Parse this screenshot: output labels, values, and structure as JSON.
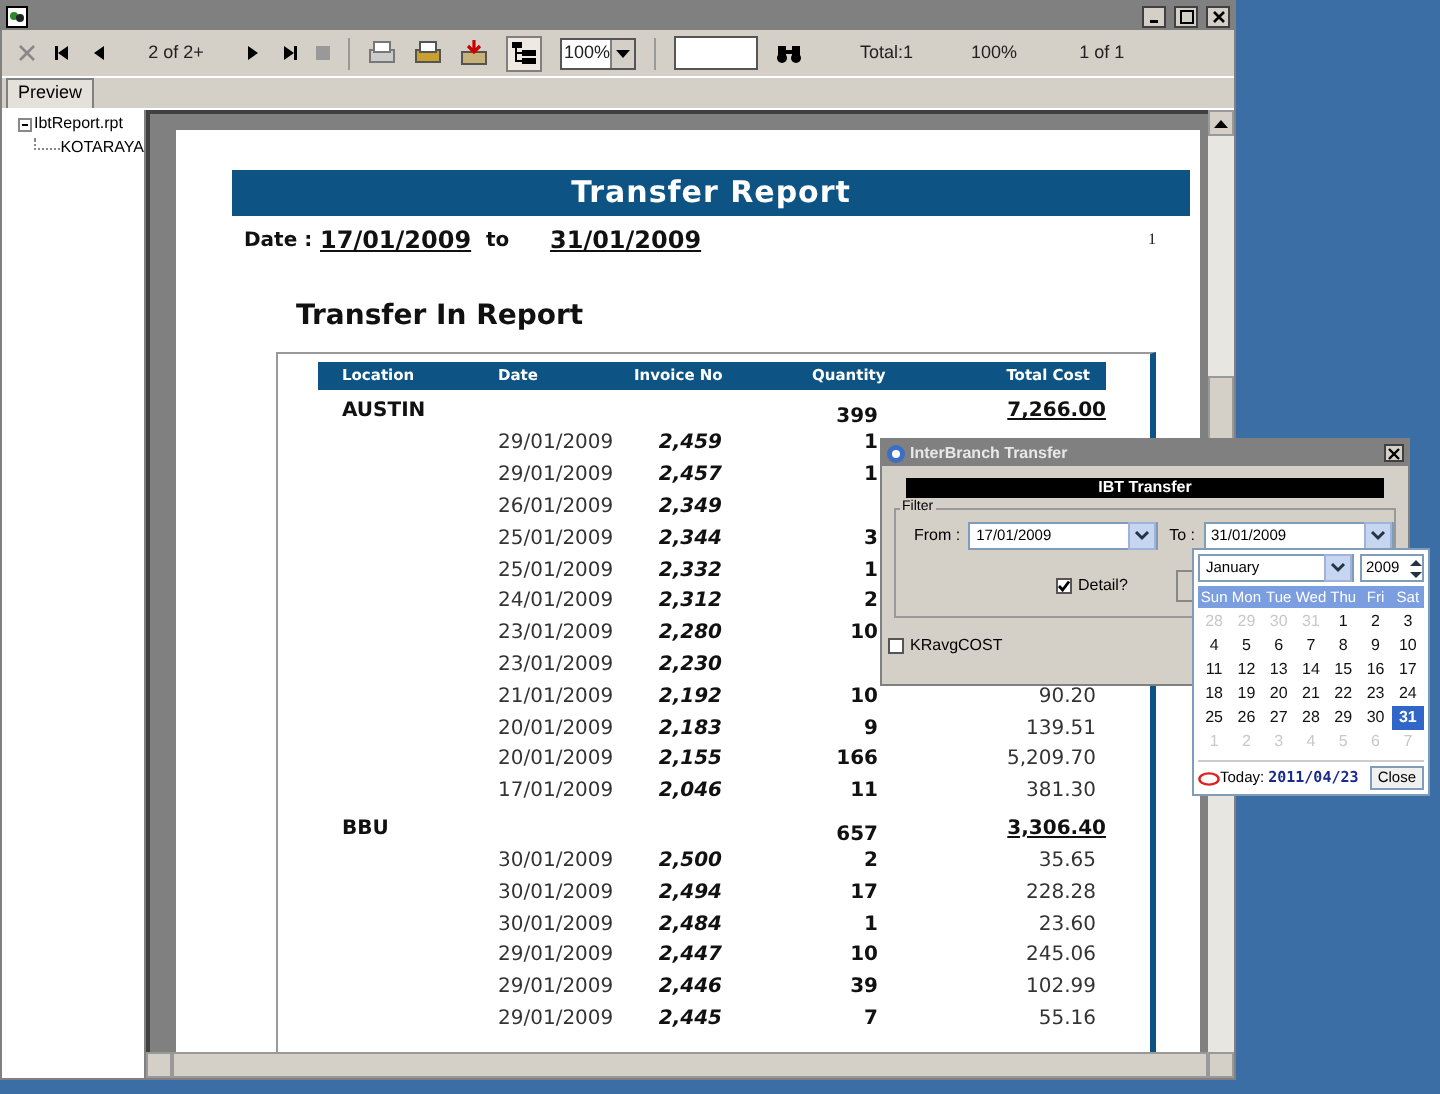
{
  "toolbar": {
    "page_indicator": "2 of 2+",
    "zoom": "100%",
    "total": "Total:1",
    "percent": "100%",
    "pages": "1 of 1",
    "group_tree_pressed": true
  },
  "tabs": [
    {
      "label": "Preview",
      "selected": true
    }
  ],
  "tree": {
    "label": "IbtReport.rpt",
    "expanded": true,
    "children": [
      {
        "label": "KOTARAYA"
      }
    ]
  },
  "report": {
    "title": "Transfer Report",
    "date_label": "Date :",
    "date_from": "17/01/2009",
    "date_to_label": "to",
    "date_to": "31/01/2009",
    "page_number": "1",
    "subtitle": "Transfer In Report",
    "columns": [
      "Location",
      "Date",
      "Invoice No",
      "Quantity",
      "Total Cost"
    ],
    "groups": [
      {
        "location": "AUSTIN",
        "quantity": "399",
        "total_cost": "7,266.00",
        "rows": [
          {
            "date": "29/01/2009",
            "invoice": "2,459",
            "quantity": "1"
          },
          {
            "date": "29/01/2009",
            "invoice": "2,457",
            "quantity": "1"
          },
          {
            "date": "26/01/2009",
            "invoice": "2,349"
          },
          {
            "date": "25/01/2009",
            "invoice": "2,344",
            "quantity": "3"
          },
          {
            "date": "25/01/2009",
            "invoice": "2,332",
            "quantity": "1"
          },
          {
            "date": "24/01/2009",
            "invoice": "2,312",
            "quantity": "2"
          },
          {
            "date": "23/01/2009",
            "invoice": "2,280",
            "quantity": "10"
          },
          {
            "date": "23/01/2009",
            "invoice": "2,230"
          },
          {
            "date": "21/01/2009",
            "invoice": "2,192",
            "quantity": "10",
            "cost": "90.20"
          },
          {
            "date": "20/01/2009",
            "invoice": "2,183",
            "quantity": "9",
            "cost": "139.51"
          },
          {
            "date": "20/01/2009",
            "invoice": "2,155",
            "quantity": "166",
            "cost": "5,209.70"
          },
          {
            "date": "17/01/2009",
            "invoice": "2,046",
            "quantity": "11",
            "cost": "381.30"
          }
        ]
      },
      {
        "location": "BBU",
        "quantity": "657",
        "total_cost": "3,306.40",
        "rows": [
          {
            "date": "30/01/2009",
            "invoice": "2,500",
            "quantity": "2",
            "cost": "35.65"
          },
          {
            "date": "30/01/2009",
            "invoice": "2,494",
            "quantity": "17",
            "cost": "228.28"
          },
          {
            "date": "30/01/2009",
            "invoice": "2,484",
            "quantity": "1",
            "cost": "23.60"
          },
          {
            "date": "29/01/2009",
            "invoice": "2,447",
            "quantity": "10",
            "cost": "245.06"
          },
          {
            "date": "29/01/2009",
            "invoice": "2,446",
            "quantity": "39",
            "cost": "102.99"
          },
          {
            "date": "29/01/2009",
            "invoice": "2,445",
            "quantity": "7",
            "cost": "55.16"
          }
        ]
      }
    ]
  },
  "dialog": {
    "title": "InterBranch Transfer",
    "header": "IBT Transfer",
    "filter_label": "Filter",
    "from_label": "From :",
    "from_value": "17/01/2009",
    "to_label": "To :",
    "to_value": "31/01/2009",
    "detail": {
      "label": "Detail?",
      "checked": true
    },
    "kravg": {
      "label": "KRavgCOST",
      "checked": false
    }
  },
  "calendar": {
    "month": "January",
    "year": "2009",
    "weekdays": [
      "Sun",
      "Mon",
      "Tue",
      "Wed",
      "Thu",
      "Fri",
      "Sat"
    ],
    "weeks": [
      [
        {
          "day": "28",
          "muted": true,
          "selected": false
        },
        {
          "day": "29",
          "muted": true,
          "selected": false
        },
        {
          "day": "30",
          "muted": true,
          "selected": false
        },
        {
          "day": "31",
          "muted": true,
          "selected": false
        },
        {
          "day": "1",
          "muted": false,
          "selected": false
        },
        {
          "day": "2",
          "muted": false,
          "selected": false
        },
        {
          "day": "3",
          "muted": false,
          "selected": false
        }
      ],
      [
        {
          "day": "4",
          "muted": false,
          "selected": false
        },
        {
          "day": "5",
          "muted": false,
          "selected": false
        },
        {
          "day": "6",
          "muted": false,
          "selected": false
        },
        {
          "day": "7",
          "muted": false,
          "selected": false
        },
        {
          "day": "8",
          "muted": false,
          "selected": false
        },
        {
          "day": "9",
          "muted": false,
          "selected": false
        },
        {
          "day": "10",
          "muted": false,
          "selected": false
        }
      ],
      [
        {
          "day": "11",
          "muted": false,
          "selected": false
        },
        {
          "day": "12",
          "muted": false,
          "selected": false
        },
        {
          "day": "13",
          "muted": false,
          "selected": false
        },
        {
          "day": "14",
          "muted": false,
          "selected": false
        },
        {
          "day": "15",
          "muted": false,
          "selected": false
        },
        {
          "day": "16",
          "muted": false,
          "selected": false
        },
        {
          "day": "17",
          "muted": false,
          "selected": false
        }
      ],
      [
        {
          "day": "18",
          "muted": false,
          "selected": false
        },
        {
          "day": "19",
          "muted": false,
          "selected": false
        },
        {
          "day": "20",
          "muted": false,
          "selected": false
        },
        {
          "day": "21",
          "muted": false,
          "selected": false
        },
        {
          "day": "22",
          "muted": false,
          "selected": false
        },
        {
          "day": "23",
          "muted": false,
          "selected": false
        },
        {
          "day": "24",
          "muted": false,
          "selected": false
        }
      ],
      [
        {
          "day": "25",
          "muted": false,
          "selected": false
        },
        {
          "day": "26",
          "muted": false,
          "selected": false
        },
        {
          "day": "27",
          "muted": false,
          "selected": false
        },
        {
          "day": "28",
          "muted": false,
          "selected": false
        },
        {
          "day": "29",
          "muted": false,
          "selected": false
        },
        {
          "day": "30",
          "muted": false,
          "selected": false
        },
        {
          "day": "31",
          "muted": false,
          "selected": true
        }
      ],
      [
        {
          "day": "1",
          "muted": true,
          "selected": false
        },
        {
          "day": "2",
          "muted": true,
          "selected": false
        },
        {
          "day": "3",
          "muted": true,
          "selected": false
        },
        {
          "day": "4",
          "muted": true,
          "selected": false
        },
        {
          "day": "5",
          "muted": true,
          "selected": false
        },
        {
          "day": "6",
          "muted": true,
          "selected": false
        },
        {
          "day": "7",
          "muted": true,
          "selected": false
        }
      ]
    ],
    "today_label": "Today:",
    "today_value": "2011/04/23",
    "close_label": "Close"
  }
}
